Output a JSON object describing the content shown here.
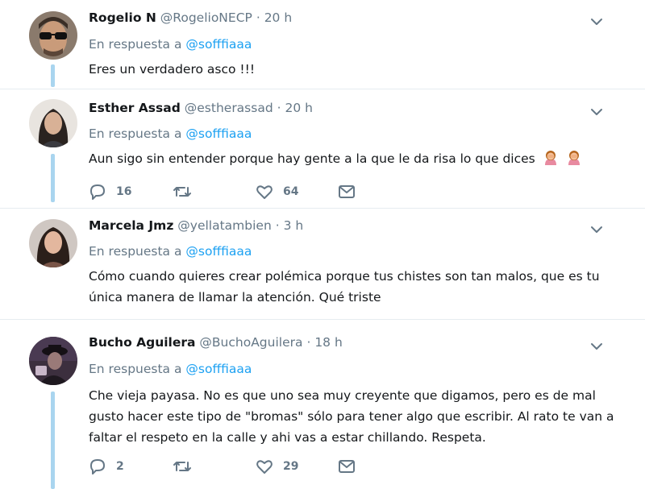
{
  "reply_prefix": "En respuesta a",
  "colors": {
    "link": "#1da1f2",
    "secondary_text": "#657786",
    "thread_line": "#a9d5ef",
    "divider": "#e6ecf0"
  },
  "tweets": [
    {
      "name": "Rogelio N",
      "handle": "@RogelioNECP",
      "separator": "·",
      "time": "20 h",
      "reply_to": "@sofffiaaa",
      "text": "Eres un verdadero asco !!!"
    },
    {
      "name": "Esther Assad",
      "handle": "@estherassad",
      "separator": "·",
      "time": "20 h",
      "reply_to": "@sofffiaaa",
      "text": "Aun sigo sin entender porque hay gente a la que le da risa lo que dices",
      "emoji": [
        "woman-facepalming-emoji",
        "woman-facepalming-emoji"
      ],
      "replies": "16",
      "likes": "64"
    },
    {
      "name": "Marcela Jmz",
      "handle": "@yellatambien",
      "separator": "·",
      "time": "3 h",
      "reply_to": "@sofffiaaa",
      "text": "Cómo cuando quieres crear polémica porque tus chistes son tan malos, que es tu única manera de llamar la atención. Qué triste"
    },
    {
      "name": "Bucho Aguilera",
      "handle": "@BuchoAguilera",
      "separator": "·",
      "time": "18 h",
      "reply_to": "@sofffiaaa",
      "text": "Che vieja payasa. No es que uno sea muy creyente que digamos, pero es de mal gusto hacer este tipo de \"bromas\" sólo para tener algo que escribir. Al rato te van a faltar el respeto en la calle y ahi vas a estar chillando. Respeta.",
      "replies": "2",
      "likes": "29"
    }
  ]
}
